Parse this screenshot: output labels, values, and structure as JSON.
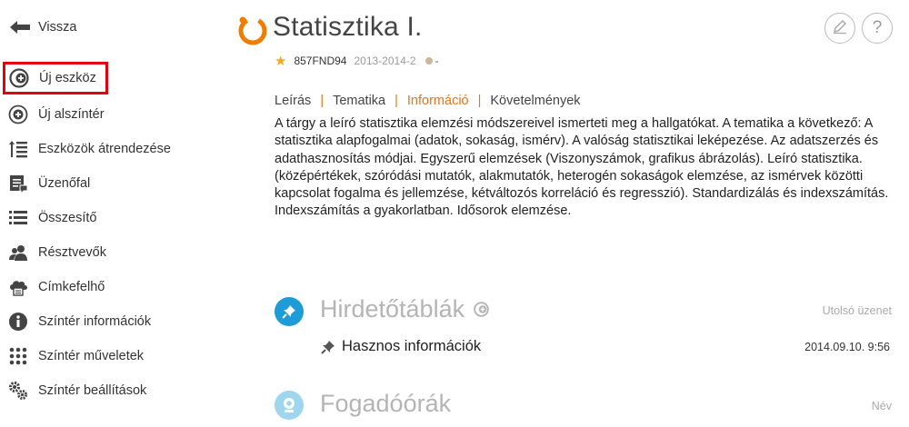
{
  "sidebar": {
    "back_label": "Vissza",
    "items": [
      {
        "label": "Új eszköz",
        "icon": "add-tool-icon"
      },
      {
        "label": "Új alszíntér",
        "icon": "add-circle-icon"
      },
      {
        "label": "Eszközök átrendezése",
        "icon": "reorder-icon"
      },
      {
        "label": "Üzenőfal",
        "icon": "message-board-icon"
      },
      {
        "label": "Összesítő",
        "icon": "list-icon"
      },
      {
        "label": "Résztvevők",
        "icon": "users-icon"
      },
      {
        "label": "Címkefelhő",
        "icon": "tag-cloud-icon"
      },
      {
        "label": "Színtér információk",
        "icon": "info-icon"
      },
      {
        "label": "Színtér műveletek",
        "icon": "grid-dots-icon"
      },
      {
        "label": "Színtér beállítások",
        "icon": "gears-icon"
      }
    ]
  },
  "header": {
    "title": "Statisztika I.",
    "code": "857FND94",
    "term": "2013-2014-2",
    "status": "-"
  },
  "tabs": [
    {
      "label": "Leírás",
      "active": false
    },
    {
      "label": "Tematika",
      "active": false
    },
    {
      "label": "Információ",
      "active": true
    },
    {
      "label": "Követelmények",
      "active": false
    }
  ],
  "description": "A tárgy a leíró statisztika elemzési módszereivel ismerteti meg a hallgatókat.  A tematika a következő: A statisztika alapfogalmai (adatok, sokaság, ismérv). A valóság statisztikai leképezése. Az adatszerzés és adathasznosítás módjai. Egyszerű elemzések (Viszonyszámok, grafikus ábrázolás). Leíró statisztika. (középértékek, szóródási mutatók, alakmutatók, heterogén sokaságok elemzése, az ismérvek közötti kapcsolat fogalma és jellemzése, kétváltozós korreláció és regresszió). Standardizálás és indexszámítás. Indexszámítás a gyakorlatban. Idősorok elemzése.",
  "bulletin": {
    "title": "Hirdetőtáblák",
    "right_label": "Utolsó üzenet",
    "entry_title": "Hasznos információk",
    "entry_date": "2014.09.10. 9:56"
  },
  "office_hours": {
    "title": "Fogadóórák",
    "right_label": "Név"
  },
  "colors": {
    "accent_orange": "#e8731a",
    "section_blue": "#1e9cd7",
    "highlight_red": "#e3000f"
  }
}
